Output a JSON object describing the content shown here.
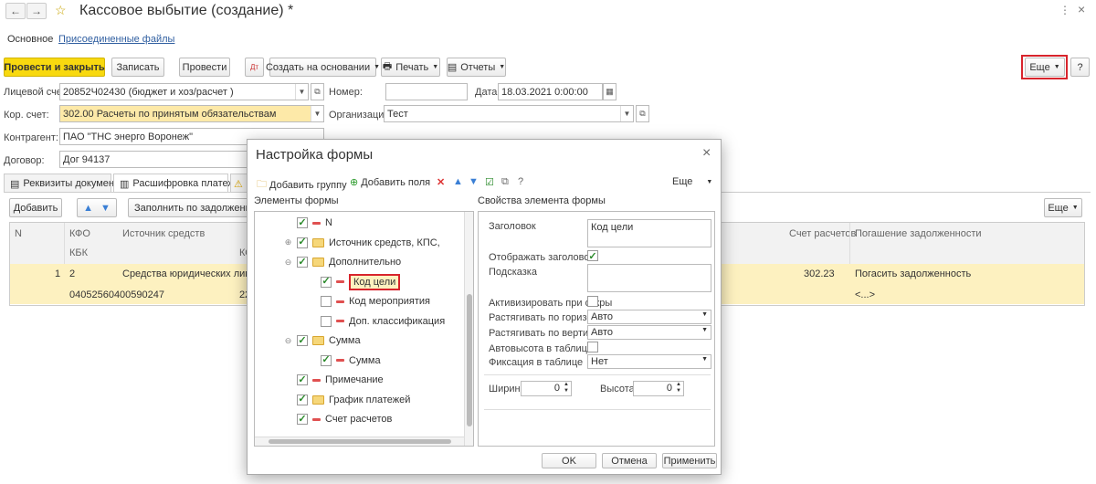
{
  "window": {
    "title": "Кассовое выбытие (создание) *",
    "back_icon": "arrow-left-icon",
    "forward_icon": "arrow-right-icon"
  },
  "tabs": [
    "Основное",
    "Присоединенные файлы"
  ],
  "toolbar": {
    "post_close": "Провести и закрыть",
    "save": "Записать",
    "post": "Провести",
    "create_based": "Создать на основании",
    "print": "Печать",
    "reports": "Отчеты",
    "more": "Еще",
    "help": "?"
  },
  "form": {
    "account_label": "Лицевой счет:",
    "account_value": "20852Ч02430 (бюджет и хоз/расчет )",
    "number_label": "Номер:",
    "number_value": "",
    "date_label": "Дата:",
    "date_value": "18.03.2021  0:00:00",
    "corr_label": "Кор. счет:",
    "corr_value": "302.00 Расчеты по принятым обязательствам",
    "org_label": "Организация:",
    "org_value": "Тест",
    "contractor_label": "Контрагент:",
    "contractor_value": "ПАО \"ТНС энерго Воронеж\"",
    "contract_label": "Договор:",
    "contract_value": "Дог 94137"
  },
  "subtabs": [
    "Реквизиты документа",
    "Расшифровка платежа"
  ],
  "table_toolbar": {
    "add": "Добавить",
    "fill": "Заполнить по задолженности",
    "more": "Еще"
  },
  "table": {
    "headers": {
      "n": "N",
      "kfo": "КФО",
      "kbk": "КБК",
      "source": "Источник средств",
      "ko": "КО",
      "account": "Счет расчетов",
      "repay": "Погашение задолженности"
    },
    "rows": [
      {
        "n": "1",
        "kfo": "2",
        "source": "Средства юридических лиц",
        "kbk": "04052560400590247",
        "ko": "22",
        "account": "302.23",
        "repay": "Погасить задолженность",
        "repay2": "<...>"
      }
    ]
  },
  "dialog": {
    "title": "Настройка формы",
    "close": "×",
    "add_group": "Добавить группу",
    "add_fields": "Добавить поля",
    "more": "Еще",
    "left_header": "Элементы формы",
    "right_header": "Свойства элемента формы",
    "tree": [
      {
        "label": "N",
        "checked": true,
        "icon": "dash",
        "level": 1,
        "exp": ""
      },
      {
        "label": "Источник средств, КПС,",
        "checked": true,
        "icon": "folder",
        "level": 1,
        "exp": "⊕"
      },
      {
        "label": "Дополнительно",
        "checked": true,
        "icon": "folder",
        "level": 1,
        "exp": "⊖"
      },
      {
        "label": "Код цели",
        "checked": true,
        "icon": "dash",
        "level": 2,
        "exp": "",
        "highlight": true
      },
      {
        "label": "Код мероприятия",
        "checked": false,
        "icon": "dash",
        "level": 2,
        "exp": ""
      },
      {
        "label": "Доп. классификация",
        "checked": false,
        "icon": "dash",
        "level": 2,
        "exp": ""
      },
      {
        "label": "Сумма",
        "checked": true,
        "icon": "folder",
        "level": 1,
        "exp": "⊖"
      },
      {
        "label": "Сумма",
        "checked": true,
        "icon": "dash",
        "level": 2,
        "exp": ""
      },
      {
        "label": "Примечание",
        "checked": true,
        "icon": "dash",
        "level": 1,
        "exp": ""
      },
      {
        "label": "График платежей",
        "checked": true,
        "icon": "folder",
        "level": 1,
        "exp": ""
      },
      {
        "label": "Счет расчетов",
        "checked": true,
        "icon": "dash",
        "level": 1,
        "exp": ""
      }
    ],
    "props": {
      "title_label": "Заголовок",
      "title_value": "Код цели",
      "show_title_label": "Отображать заголовок",
      "hint_label": "Подсказка",
      "activate_label": "Активизировать при откры",
      "stretch_h_label": "Растягивать по горизонта",
      "stretch_h_value": "Авто",
      "stretch_v_label": "Растягивать по вертикал",
      "stretch_v_value": "Авто",
      "autoheight_label": "Автовысота в таблице",
      "fix_label": "Фиксация в таблице",
      "fix_value": "Нет",
      "width_label": "Ширина",
      "width_value": "0",
      "height_label": "Высота",
      "height_value": "0"
    },
    "ok": "OK",
    "cancel": "Отмена",
    "apply": "Применить"
  },
  "colors": {
    "accent_yellow": "#f8d90f",
    "row_highlight": "#fdf1c0",
    "red_frame": "#d8242c",
    "link": "#2f5ea0"
  }
}
